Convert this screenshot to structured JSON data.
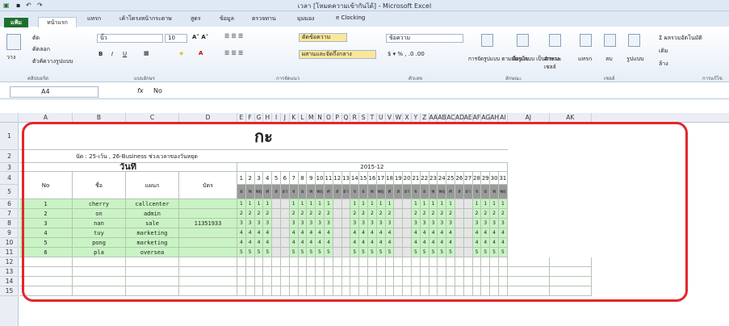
{
  "window": {
    "title": "เวลา [โหมดความเข้ากันได้] - Microsoft Excel"
  },
  "tabs": {
    "file": "แฟ้ม",
    "home": "หน้าแรก",
    "insert": "แทรก",
    "layout": "เค้าโครงหน้ากระดาษ",
    "formulas": "สูตร",
    "data": "ข้อมูล",
    "review": "ตรวจทาน",
    "view": "มุมมอง",
    "eclocking": "e Clocking"
  },
  "ribbon": {
    "paste": "วาง",
    "cut": "ตัด",
    "copy": "คัดลอก",
    "format_painter": "ตัวคัดวางรูปแบบ",
    "clipboard": "คลิปบอร์ด",
    "font_name": "นิ้ว",
    "font_size": "10",
    "font_group": "แบบอักษร",
    "wrap": "ตัดข้อความ",
    "merge": "ผสานและจัดกึ่งกลาง",
    "alignment": "การจัดแนว",
    "number_format": "ข้อความ",
    "number": "ตัวเลข",
    "cond_format": "การจัดรูปแบบ ตามเงื่อนไข",
    "format_table": "จัดรูปแบบ เป็นตาราง",
    "cell_styles": "ลักษณะ เซลล์",
    "styles": "ลักษณะ",
    "insert_btn": "แทรก",
    "delete_btn": "ลบ",
    "format_btn": "รูปแบบ",
    "cells": "เซลล์",
    "autosum": "ผลรวมอัตโนมัติ",
    "fill": "เติม",
    "clear": "ล้าง",
    "editing": "การแก้ไข"
  },
  "formula_bar": {
    "name": "A4",
    "value": "No"
  },
  "columns": [
    "A",
    "B",
    "C",
    "D",
    "E",
    "F",
    "G",
    "H",
    "I",
    "J",
    "K",
    "L",
    "M",
    "N",
    "O",
    "P",
    "Q",
    "R",
    "S",
    "T",
    "U",
    "V",
    "W",
    "X",
    "Y",
    "Z",
    "AA",
    "AB",
    "AC",
    "AD",
    "AE",
    "AF",
    "AG",
    "AH",
    "AI",
    "AJ",
    "AK"
  ],
  "rows": [
    "1",
    "2",
    "3",
    "4",
    "5",
    "6",
    "7",
    "8",
    "9",
    "10",
    "11",
    "12",
    "13",
    "14",
    "15"
  ],
  "sheet": {
    "title": "กะ",
    "note": "นัด : 25-เว้น , 26-Business ช่วงเวลาของวันหยุด",
    "date_header": "วันที่",
    "month": "2015-12",
    "headers": [
      "No",
      "ชื่อ",
      "แผนก",
      "บัตร"
    ],
    "days": [
      "1",
      "2",
      "3",
      "4",
      "5",
      "6",
      "7",
      "8",
      "9",
      "10",
      "11",
      "12",
      "13",
      "14",
      "15",
      "16",
      "17",
      "18",
      "19",
      "20",
      "21",
      "22",
      "23",
      "24",
      "25",
      "26",
      "27",
      "28",
      "29",
      "30",
      "31"
    ],
    "weekdays": [
      "อ",
      "พ",
      "พฤ",
      "ศ",
      "ส",
      "อา",
      "จ",
      "อ",
      "พ",
      "พฤ",
      "ศ",
      "ส",
      "อา",
      "จ",
      "อ",
      "พ",
      "พฤ",
      "ศ",
      "ส",
      "อา",
      "จ",
      "อ",
      "พ",
      "พฤ",
      "ศ",
      "ส",
      "อา",
      "จ",
      "อ",
      "พ",
      "พฤ"
    ],
    "staff": [
      {
        "no": "1",
        "name": "cherry",
        "dept": "callcenter",
        "card": "",
        "shift": "1"
      },
      {
        "no": "2",
        "name": "on",
        "dept": "admin",
        "card": "",
        "shift": "2"
      },
      {
        "no": "3",
        "name": "nan",
        "dept": "sale",
        "card": "11351933",
        "shift": "3"
      },
      {
        "no": "4",
        "name": "tuy",
        "dept": "marketing",
        "card": "",
        "shift": "4"
      },
      {
        "no": "5",
        "name": "pong",
        "dept": "marketing",
        "card": "",
        "shift": "4"
      },
      {
        "no": "6",
        "name": "pla",
        "dept": "oversea",
        "card": "",
        "shift": "5"
      }
    ]
  },
  "colors": {
    "frame": "#e3262d",
    "band": "#c9f3c4",
    "weekday_bg": "#9a9a9a"
  }
}
